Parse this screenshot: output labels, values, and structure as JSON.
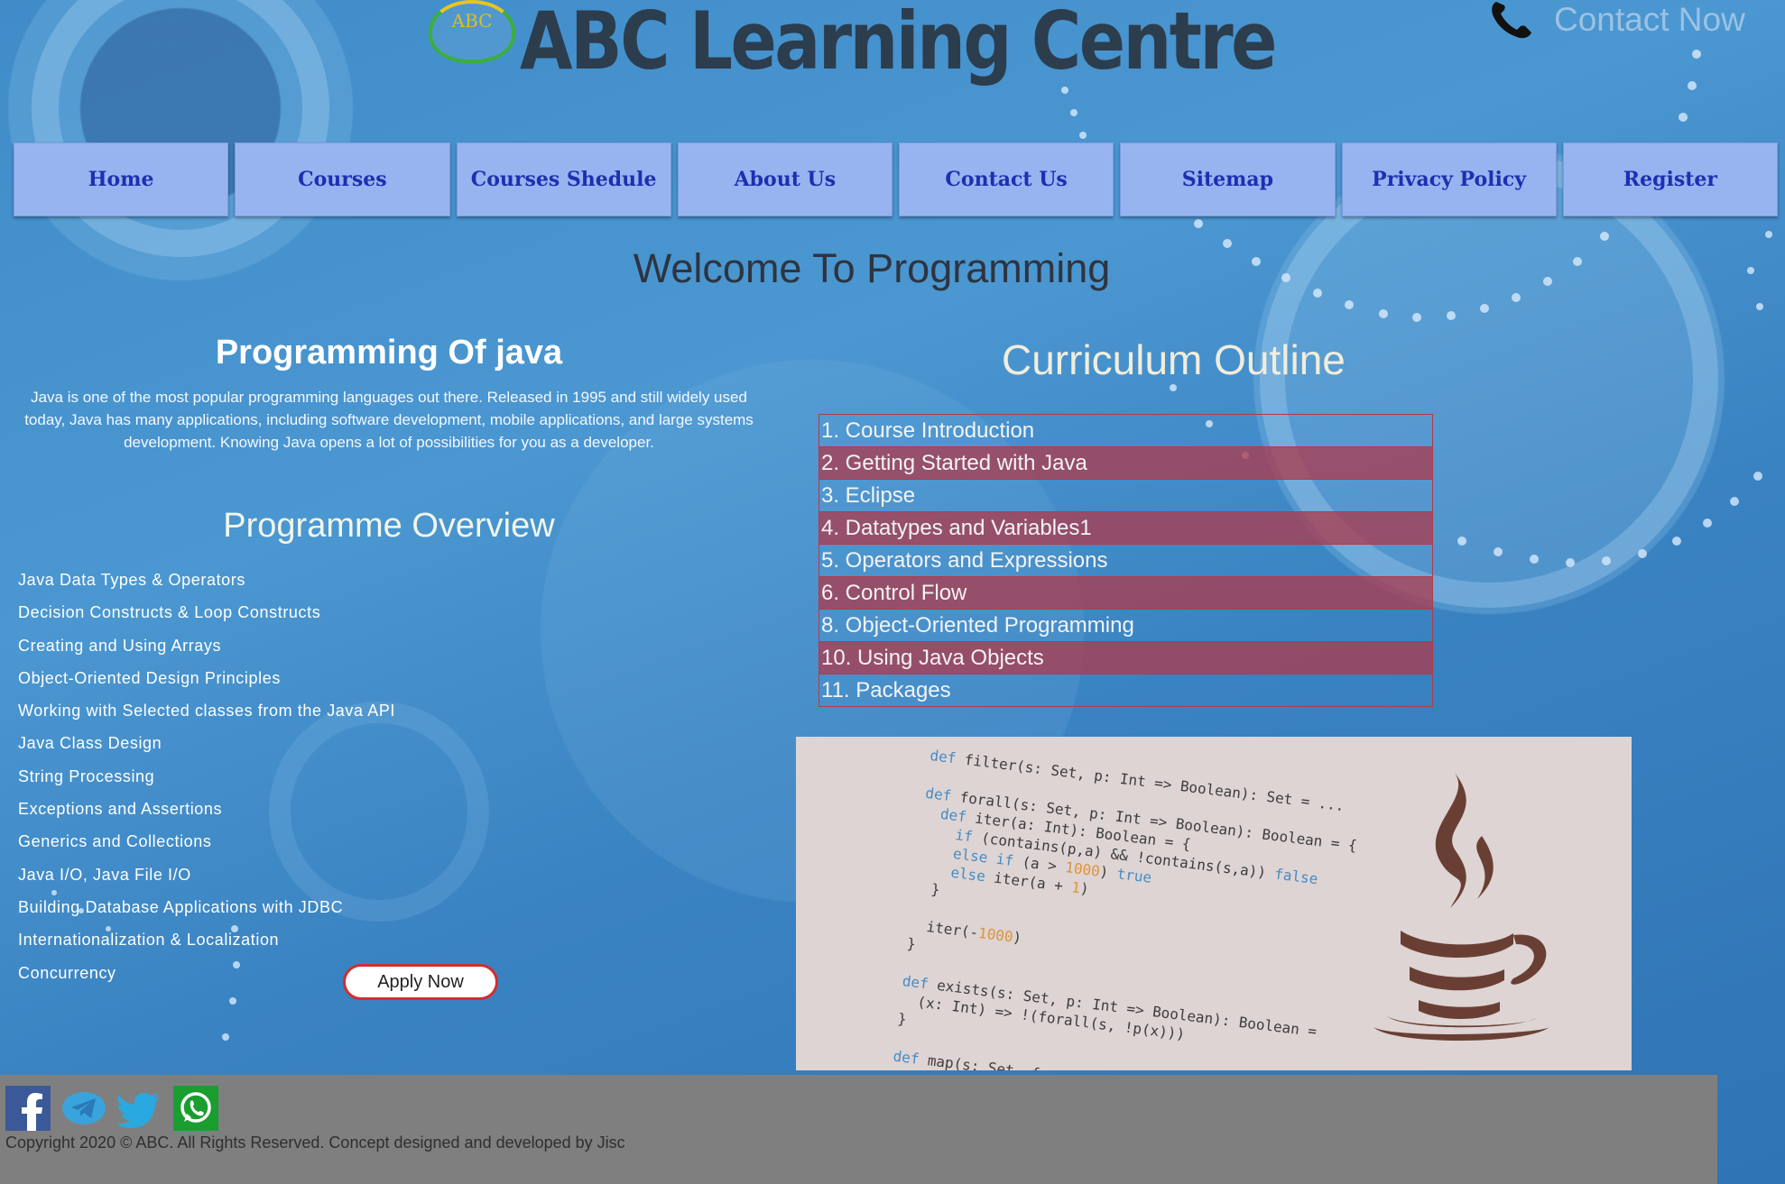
{
  "header": {
    "logo_text": "ABC",
    "site_title": "ABC Learning Centre",
    "contact_label": "Contact Now",
    "phone_icon": "phone-icon"
  },
  "nav": {
    "items": [
      {
        "label": "Home"
      },
      {
        "label": "Courses"
      },
      {
        "label": "Courses Shedule"
      },
      {
        "label": "About Us"
      },
      {
        "label": "Contact Us"
      },
      {
        "label": "Sitemap"
      },
      {
        "label": "Privacy Policy"
      },
      {
        "label": "Register"
      }
    ]
  },
  "main": {
    "welcome": "Welcome To Programming",
    "left": {
      "title": "Programming Of java",
      "description": "Java is one of the most popular programming languages out there. Released in 1995 and still widely used today, Java has many applications, including software development, mobile applications, and large systems development. Knowing Java opens a lot of possibilities for you as a developer.",
      "overview_title": "Programme Overview",
      "overview_items": [
        "Java Data Types & Operators",
        "Decision Constructs & Loop Constructs",
        "Creating and Using Arrays",
        "Object-Oriented Design Principles",
        "Working with Selected classes from the Java API",
        "Java Class Design",
        "String Processing",
        "Exceptions and Assertions",
        "Generics and Collections",
        "Java I/O, Java File I/O",
        "Building Database Applications with JDBC",
        "Internationalization & Localization",
        "Concurrency"
      ],
      "apply_label": "Apply Now"
    },
    "curriculum": {
      "title": "Curriculum Outline",
      "items": [
        "1. Course Introduction",
        "2. Getting Started with Java",
        "3. Eclipse",
        "4. Datatypes and Variables1",
        "5. Operators and Expressions",
        "6. Control Flow",
        "8. Object-Oriented Programming",
        "10. Using Java Objects",
        "11. Packages"
      ]
    }
  },
  "colors": {
    "nav_bg": "#97b4f0",
    "nav_text": "#1f2fb0",
    "row_highlight": "#aa3c50",
    "apply_border": "#d32d2d",
    "footer_bg": "#7f7f7f"
  },
  "footer": {
    "social_icons": [
      "facebook-icon",
      "telegram-icon",
      "twitter-icon",
      "whatsapp-icon"
    ],
    "copyright": "Copyright 2020 © ABC. All Rights Reserved. Concept designed and developed by Jisc"
  }
}
